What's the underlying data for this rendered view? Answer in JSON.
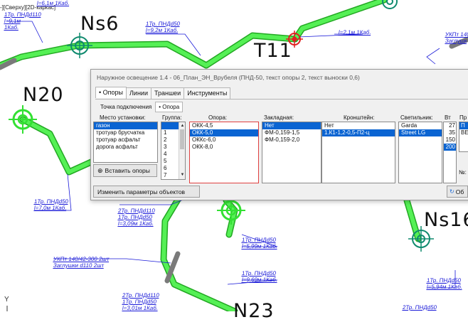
{
  "viewport": {
    "label": "-][Сверху][2D-каркас]"
  },
  "cad": {
    "nodes": [
      "Ns6",
      "T11",
      "N20",
      "Ns16",
      "N23"
    ],
    "labels": [
      "1Тр. ПНДd110",
      "l=6,1м 1Каб.",
      "l=9,1м",
      "1Каб.",
      "1Тр. ПНДd50",
      "l=9,2м 1Каб.",
      "l=2,1м 1Каб.",
      "УКПт 140/42",
      "Заглушк",
      "1Тр. ПНДd50",
      "l=7,0м 1Каб.",
      "2Тр. ПНДd110",
      "1Тр. ПНДd50",
      "l=3,09м 1Каб.",
      "1Тр. ПНДd50",
      "l=5,99м 1Каб.",
      "УКПт 140/42-300 2шт",
      "Заглушки d110 2шт",
      "1Тр. ПНДd50",
      "l=9,69м 1Каб.",
      "2Тр. ПНДd110",
      "1Тр. ПНДd50",
      "l=3,01м 1Каб.",
      "1Тр. ПНДd50",
      "l=5,94м 1Каб.",
      "2Тр. ПНДd50"
    ],
    "axis_label": "Y",
    "colors": {
      "route": "#33e033",
      "route_dark": "#22a822",
      "node": "#0f8a6e",
      "label": "#1a1ad8",
      "selected": "#e02020",
      "gray_segment": "#7a7a7a"
    }
  },
  "dialog": {
    "title": "Наружное освещение 1.4 - 06_План_ЭН_Врубеля  (ПНД-50, текст опоры 2, текст выноски 0,6)",
    "tabs": [
      "• Опоры",
      "Линии",
      "Траншеи",
      "Инструменты"
    ],
    "subtabs": [
      "Точка подключения",
      "• Опора"
    ],
    "columns": {
      "place": "Место установки:",
      "group": "Группа:",
      "support": "Опора:",
      "embed": "Закладная:",
      "bracket": "Кронштейн:",
      "lamp": "Светильник:",
      "watt": "Вт",
      "extra": "Пр"
    },
    "place_items": [
      "газон",
      "тротуар брусчатка",
      "тротуар асфальт",
      "дорога асфальт"
    ],
    "group_items": [
      "",
      "1",
      "2",
      "3",
      "4",
      "5",
      "6",
      "7"
    ],
    "support_items": [
      "ОКК-4,5",
      "ОКК-5,0",
      "ОККс-6,0",
      "ОКК-8,0"
    ],
    "embed_items": [
      "Нет",
      "ФМ-0,159-1,5",
      "ФМ-0,159-2,0"
    ],
    "bracket_items": [
      "Нет",
      "1.К1-1,2-0,5-П2-ц"
    ],
    "lamp_items": [
      "Garda",
      "Street LG"
    ],
    "watt_items": [
      "27",
      "35",
      "150",
      "200"
    ],
    "extra_items": [
      "П",
      "ВЕ"
    ],
    "number_label": "№:",
    "insert_button": "Вставить опоры",
    "change_button": "Изменить параметры объектов",
    "update_button": "Об"
  }
}
